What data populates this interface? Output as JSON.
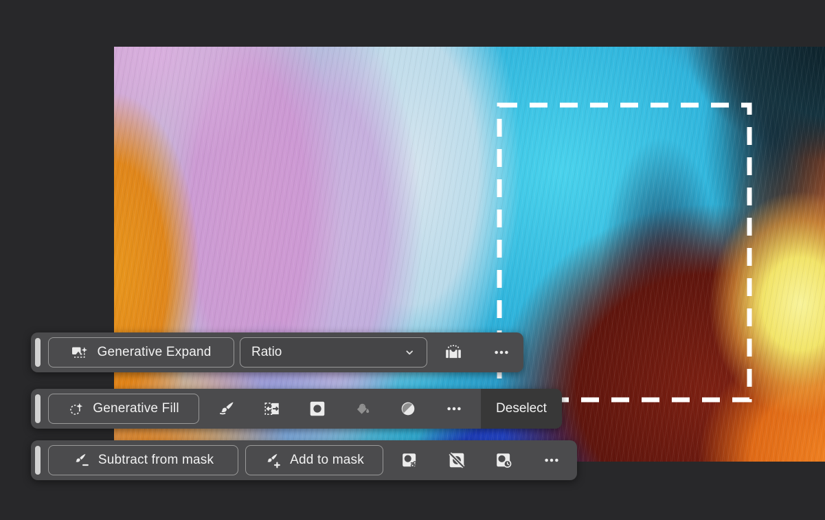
{
  "window": {
    "background_color": "#28282a",
    "canvas_description": "colorful abstract fluid-art image open in editor"
  },
  "selection": {
    "visible": true,
    "style": "dashed-marquee",
    "stroke_color": "#ffffff"
  },
  "taskbar_expand": {
    "button_label": "Generative Expand",
    "dropdown_value": "Ratio",
    "icons": [
      "generative-expand-icon",
      "chevron-down-icon",
      "generate-image-icon",
      "more-options-icon"
    ]
  },
  "taskbar_fill": {
    "button_label": "Generative Fill",
    "deselect_label": "Deselect",
    "icons": [
      "generative-fill-icon",
      "brush-icon",
      "transform-selection-icon",
      "mask-icon",
      "paint-bucket-icon",
      "contrast-icon",
      "more-options-icon"
    ]
  },
  "taskbar_mask": {
    "subtract_label": "Subtract from mask",
    "add_label": "Add to mask",
    "icons": [
      "subtract-from-mask-icon",
      "add-to-mask-icon",
      "mask-settings-icon",
      "hide-mask-overlay-icon",
      "mask-clock-icon",
      "more-options-icon"
    ]
  },
  "colors": {
    "taskbar_background": "#4b4b4d",
    "deselect_segment_background": "#383838",
    "button_border": "#9a9a9a",
    "text": "#f2f2f2",
    "drag_handle": "#d2d2d2",
    "disabled_icon": "#909090"
  }
}
